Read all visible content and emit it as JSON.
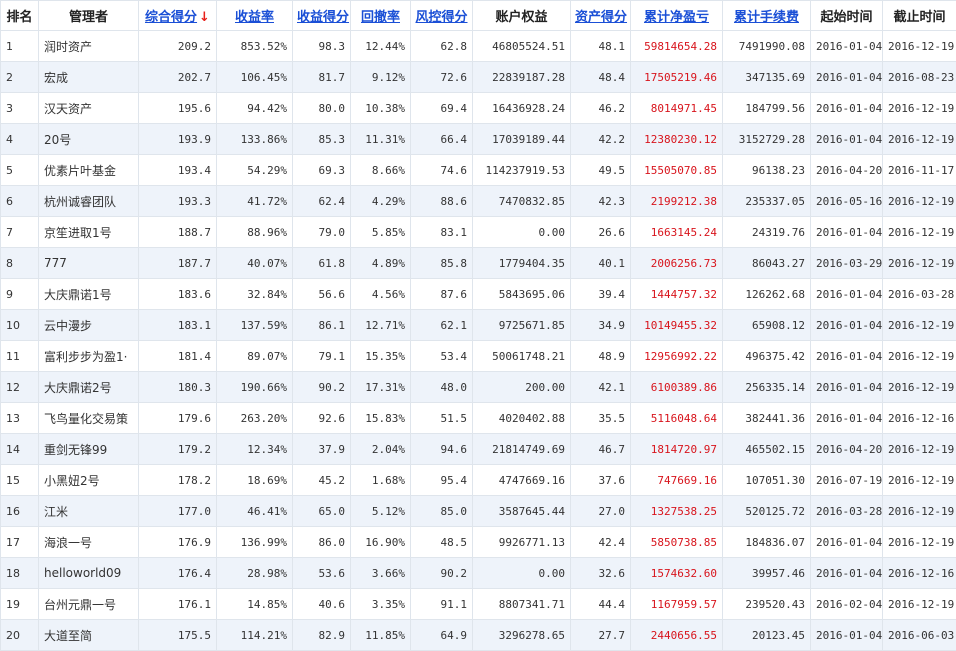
{
  "table": {
    "columns": [
      {
        "key": "rank",
        "label": "排名",
        "sortable": false
      },
      {
        "key": "manager",
        "label": "管理者",
        "sortable": false
      },
      {
        "key": "total_score",
        "label": "综合得分",
        "sortable": true,
        "sorted_desc": true
      },
      {
        "key": "return_rate",
        "label": "收益率",
        "sortable": true
      },
      {
        "key": "return_score",
        "label": "收益得分",
        "sortable": true
      },
      {
        "key": "drawdown",
        "label": "回撤率",
        "sortable": true
      },
      {
        "key": "risk_score",
        "label": "风控得分",
        "sortable": true
      },
      {
        "key": "equity",
        "label": "账户权益",
        "sortable": false
      },
      {
        "key": "asset_score",
        "label": "资产得分",
        "sortable": true
      },
      {
        "key": "net_pnl",
        "label": "累计净盈亏",
        "sortable": true
      },
      {
        "key": "fees",
        "label": "累计手续费",
        "sortable": true
      },
      {
        "key": "start",
        "label": "起始时间",
        "sortable": false
      },
      {
        "key": "end",
        "label": "截止时间",
        "sortable": false
      }
    ],
    "sort_indicator_color": "#e8201a",
    "pnl_color": "#d8141c",
    "link_color": "#1a4fd6",
    "stripe_color": "#eef3fa",
    "rows": [
      {
        "rank": "1",
        "manager": "润时资产",
        "total_score": "209.2",
        "return_rate": "853.52%",
        "return_score": "98.3",
        "drawdown": "12.44%",
        "risk_score": "62.8",
        "equity": "46805524.51",
        "asset_score": "48.1",
        "net_pnl": "59814654.28",
        "fees": "7491990.08",
        "start": "2016-01-04",
        "end": "2016-12-19"
      },
      {
        "rank": "2",
        "manager": "宏成",
        "total_score": "202.7",
        "return_rate": "106.45%",
        "return_score": "81.7",
        "drawdown": "9.12%",
        "risk_score": "72.6",
        "equity": "22839187.28",
        "asset_score": "48.4",
        "net_pnl": "17505219.46",
        "fees": "347135.69",
        "start": "2016-01-04",
        "end": "2016-08-23"
      },
      {
        "rank": "3",
        "manager": "汉天资产",
        "total_score": "195.6",
        "return_rate": "94.42%",
        "return_score": "80.0",
        "drawdown": "10.38%",
        "risk_score": "69.4",
        "equity": "16436928.24",
        "asset_score": "46.2",
        "net_pnl": "8014971.45",
        "fees": "184799.56",
        "start": "2016-01-04",
        "end": "2016-12-19"
      },
      {
        "rank": "4",
        "manager": "20号",
        "total_score": "193.9",
        "return_rate": "133.86%",
        "return_score": "85.3",
        "drawdown": "11.31%",
        "risk_score": "66.4",
        "equity": "17039189.44",
        "asset_score": "42.2",
        "net_pnl": "12380230.12",
        "fees": "3152729.28",
        "start": "2016-01-04",
        "end": "2016-12-19"
      },
      {
        "rank": "5",
        "manager": "优素片叶基金",
        "total_score": "193.4",
        "return_rate": "54.29%",
        "return_score": "69.3",
        "drawdown": "8.66%",
        "risk_score": "74.6",
        "equity": "114237919.53",
        "asset_score": "49.5",
        "net_pnl": "15505070.85",
        "fees": "96138.23",
        "start": "2016-04-20",
        "end": "2016-11-17"
      },
      {
        "rank": "6",
        "manager": "杭州诚睿团队",
        "total_score": "193.3",
        "return_rate": "41.72%",
        "return_score": "62.4",
        "drawdown": "4.29%",
        "risk_score": "88.6",
        "equity": "7470832.85",
        "asset_score": "42.3",
        "net_pnl": "2199212.38",
        "fees": "235337.05",
        "start": "2016-05-16",
        "end": "2016-12-19"
      },
      {
        "rank": "7",
        "manager": "京笙进取1号",
        "total_score": "188.7",
        "return_rate": "88.96%",
        "return_score": "79.0",
        "drawdown": "5.85%",
        "risk_score": "83.1",
        "equity": "0.00",
        "asset_score": "26.6",
        "net_pnl": "1663145.24",
        "fees": "24319.76",
        "start": "2016-01-04",
        "end": "2016-12-19"
      },
      {
        "rank": "8",
        "manager": "777",
        "total_score": "187.7",
        "return_rate": "40.07%",
        "return_score": "61.8",
        "drawdown": "4.89%",
        "risk_score": "85.8",
        "equity": "1779404.35",
        "asset_score": "40.1",
        "net_pnl": "2006256.73",
        "fees": "86043.27",
        "start": "2016-03-29",
        "end": "2016-12-19"
      },
      {
        "rank": "9",
        "manager": "大庆鼎诺1号",
        "total_score": "183.6",
        "return_rate": "32.84%",
        "return_score": "56.6",
        "drawdown": "4.56%",
        "risk_score": "87.6",
        "equity": "5843695.06",
        "asset_score": "39.4",
        "net_pnl": "1444757.32",
        "fees": "126262.68",
        "start": "2016-01-04",
        "end": "2016-03-28"
      },
      {
        "rank": "10",
        "manager": "云中漫步",
        "total_score": "183.1",
        "return_rate": "137.59%",
        "return_score": "86.1",
        "drawdown": "12.71%",
        "risk_score": "62.1",
        "equity": "9725671.85",
        "asset_score": "34.9",
        "net_pnl": "10149455.32",
        "fees": "65908.12",
        "start": "2016-01-04",
        "end": "2016-12-19"
      },
      {
        "rank": "11",
        "manager": "富利步步为盈1·",
        "total_score": "181.4",
        "return_rate": "89.07%",
        "return_score": "79.1",
        "drawdown": "15.35%",
        "risk_score": "53.4",
        "equity": "50061748.21",
        "asset_score": "48.9",
        "net_pnl": "12956992.22",
        "fees": "496375.42",
        "start": "2016-01-04",
        "end": "2016-12-19"
      },
      {
        "rank": "12",
        "manager": "大庆鼎诺2号",
        "total_score": "180.3",
        "return_rate": "190.66%",
        "return_score": "90.2",
        "drawdown": "17.31%",
        "risk_score": "48.0",
        "equity": "200.00",
        "asset_score": "42.1",
        "net_pnl": "6100389.86",
        "fees": "256335.14",
        "start": "2016-01-04",
        "end": "2016-12-19"
      },
      {
        "rank": "13",
        "manager": "飞鸟量化交易策",
        "total_score": "179.6",
        "return_rate": "263.20%",
        "return_score": "92.6",
        "drawdown": "15.83%",
        "risk_score": "51.5",
        "equity": "4020402.88",
        "asset_score": "35.5",
        "net_pnl": "5116048.64",
        "fees": "382441.36",
        "start": "2016-01-04",
        "end": "2016-12-16"
      },
      {
        "rank": "14",
        "manager": "重剑无锋99",
        "total_score": "179.2",
        "return_rate": "12.34%",
        "return_score": "37.9",
        "drawdown": "2.04%",
        "risk_score": "94.6",
        "equity": "21814749.69",
        "asset_score": "46.7",
        "net_pnl": "1814720.97",
        "fees": "465502.15",
        "start": "2016-04-20",
        "end": "2016-12-19"
      },
      {
        "rank": "15",
        "manager": "小黑妞2号",
        "total_score": "178.2",
        "return_rate": "18.69%",
        "return_score": "45.2",
        "drawdown": "1.68%",
        "risk_score": "95.4",
        "equity": "4747669.16",
        "asset_score": "37.6",
        "net_pnl": "747669.16",
        "fees": "107051.30",
        "start": "2016-07-19",
        "end": "2016-12-19"
      },
      {
        "rank": "16",
        "manager": "江米",
        "total_score": "177.0",
        "return_rate": "46.41%",
        "return_score": "65.0",
        "drawdown": "5.12%",
        "risk_score": "85.0",
        "equity": "3587645.44",
        "asset_score": "27.0",
        "net_pnl": "1327538.25",
        "fees": "520125.72",
        "start": "2016-03-28",
        "end": "2016-12-19"
      },
      {
        "rank": "17",
        "manager": "海浪一号",
        "total_score": "176.9",
        "return_rate": "136.99%",
        "return_score": "86.0",
        "drawdown": "16.90%",
        "risk_score": "48.5",
        "equity": "9926771.13",
        "asset_score": "42.4",
        "net_pnl": "5850738.85",
        "fees": "184836.07",
        "start": "2016-01-04",
        "end": "2016-12-19"
      },
      {
        "rank": "18",
        "manager": "helloworld09",
        "total_score": "176.4",
        "return_rate": "28.98%",
        "return_score": "53.6",
        "drawdown": "3.66%",
        "risk_score": "90.2",
        "equity": "0.00",
        "asset_score": "32.6",
        "net_pnl": "1574632.60",
        "fees": "39957.46",
        "start": "2016-01-04",
        "end": "2016-12-16"
      },
      {
        "rank": "19",
        "manager": "台州元鼎一号",
        "total_score": "176.1",
        "return_rate": "14.85%",
        "return_score": "40.6",
        "drawdown": "3.35%",
        "risk_score": "91.1",
        "equity": "8807341.71",
        "asset_score": "44.4",
        "net_pnl": "1167959.57",
        "fees": "239520.43",
        "start": "2016-02-04",
        "end": "2016-12-19"
      },
      {
        "rank": "20",
        "manager": "大道至简",
        "total_score": "175.5",
        "return_rate": "114.21%",
        "return_score": "82.9",
        "drawdown": "11.85%",
        "risk_score": "64.9",
        "equity": "3296278.65",
        "asset_score": "27.7",
        "net_pnl": "2440656.55",
        "fees": "20123.45",
        "start": "2016-01-04",
        "end": "2016-06-03"
      }
    ]
  }
}
